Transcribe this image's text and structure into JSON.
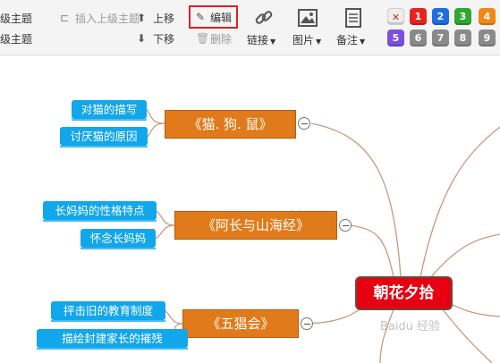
{
  "toolbar": {
    "subtopic_label": "级主题",
    "insert_parent_label": "插入上级主题",
    "sibling_label": "级主题",
    "move_up_label": "上移",
    "move_down_label": "下移",
    "edit_label": "编辑",
    "delete_label": "删除",
    "link_label": "链接",
    "image_label": "图片",
    "note_label": "备注",
    "priorities": [
      {
        "label": "✕",
        "color": "#eeeeee",
        "text_color": "#e02020"
      },
      {
        "label": "1",
        "color": "#e8231f"
      },
      {
        "label": "2",
        "color": "#1e6ee0"
      },
      {
        "label": "3",
        "color": "#2ea82e"
      },
      {
        "label": "4",
        "color": "#f08a16"
      },
      {
        "label": "5",
        "color": "#7b4fe0"
      },
      {
        "label": "6",
        "color": "#8a8a8a"
      },
      {
        "label": "7",
        "color": "#8a8a8a"
      },
      {
        "label": "8",
        "color": "#8a8a8a"
      },
      {
        "label": "9",
        "color": "#8a8a8a"
      }
    ]
  },
  "mindmap": {
    "root": "朝花夕拾",
    "topics": [
      {
        "label": "《猫. 狗. 鼠》",
        "subtopics": [
          "对猫的描写",
          "讨厌猫的原因"
        ]
      },
      {
        "label": "《阿长与山海经》",
        "subtopics": [
          "长妈妈的性格特点",
          "怀念长妈妈"
        ]
      },
      {
        "label": "《五猖会》",
        "subtopics": [
          "抨击旧的教育制度",
          "描绘封建家长的摧残"
        ]
      }
    ],
    "watermark": "Baidu 经验"
  },
  "colors": {
    "topic": "#e17a1a",
    "subtopic": "#12a6ea",
    "root": "#e60012",
    "connector": "#c79a7e"
  }
}
